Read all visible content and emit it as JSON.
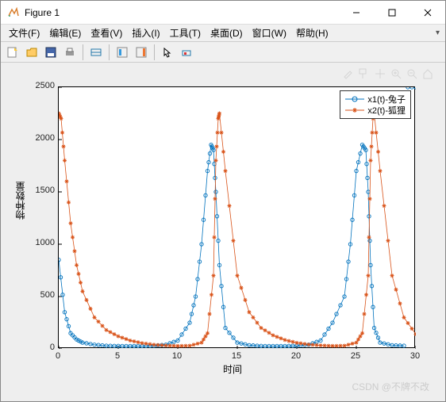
{
  "window": {
    "title": "Figure 1"
  },
  "menu": {
    "file": "文件(F)",
    "edit": "编辑(E)",
    "view": "查看(V)",
    "insert": "插入(I)",
    "tools": "工具(T)",
    "desktop": "桌面(D)",
    "window": "窗口(W)",
    "help": "帮助(H)"
  },
  "legend": {
    "s1": "x1(t)-兔子",
    "s2": "x2(t)-狐狸"
  },
  "axis": {
    "xlabel": "时间",
    "ylabel": "物种数量"
  },
  "watermark": "CSDN @不牌不改",
  "chart_data": {
    "type": "line",
    "title": "",
    "xlabel": "时间",
    "ylabel": "物种数量",
    "xlim": [
      0,
      30
    ],
    "ylim": [
      0,
      2500
    ],
    "xticks": [
      0,
      5,
      10,
      15,
      20,
      25,
      30
    ],
    "yticks": [
      0,
      500,
      1000,
      1500,
      2000,
      2500
    ],
    "series": [
      {
        "name": "x1(t)-兔子",
        "color": "#0072BD",
        "marker": "o",
        "x": [
          0,
          0.5,
          1,
          1.5,
          2,
          3,
          4,
          5,
          6,
          7,
          8,
          9,
          10,
          11,
          11.5,
          12,
          12.5,
          12.8,
          13,
          13.2,
          13.5,
          14,
          15,
          16,
          17,
          18,
          19,
          20,
          21,
          22,
          23,
          24,
          24.5,
          25,
          25.5,
          25.8,
          26,
          26.2,
          26.5,
          27,
          28,
          29,
          30
        ],
        "y": [
          850,
          350,
          150,
          90,
          60,
          40,
          30,
          28,
          27,
          27,
          30,
          40,
          80,
          250,
          500,
          1000,
          1700,
          1950,
          1900,
          1500,
          800,
          200,
          60,
          35,
          28,
          27,
          27,
          30,
          40,
          80,
          250,
          500,
          1000,
          1700,
          1950,
          1900,
          1500,
          800,
          200,
          60,
          35,
          30
        ]
      },
      {
        "name": "x2(t)-狐狸",
        "color": "#D95319",
        "marker": "*",
        "x": [
          0,
          0.2,
          0.5,
          1,
          1.5,
          2,
          3,
          4,
          5,
          6,
          7,
          8,
          9,
          10,
          11,
          12,
          12.5,
          13,
          13.2,
          13.4,
          13.5,
          14,
          15,
          16,
          17,
          18,
          19,
          20,
          21,
          22,
          23,
          24,
          25,
          25.5,
          26,
          26.2,
          26.4,
          26.5,
          27,
          28,
          29,
          30
        ],
        "y": [
          2250,
          2200,
          1800,
          1200,
          800,
          550,
          300,
          180,
          120,
          80,
          55,
          40,
          32,
          28,
          30,
          60,
          150,
          700,
          1800,
          2200,
          2250,
          1700,
          700,
          350,
          200,
          130,
          85,
          58,
          42,
          33,
          28,
          30,
          60,
          150,
          700,
          1800,
          2200,
          2250,
          1700,
          700,
          300,
          140
        ]
      }
    ]
  }
}
